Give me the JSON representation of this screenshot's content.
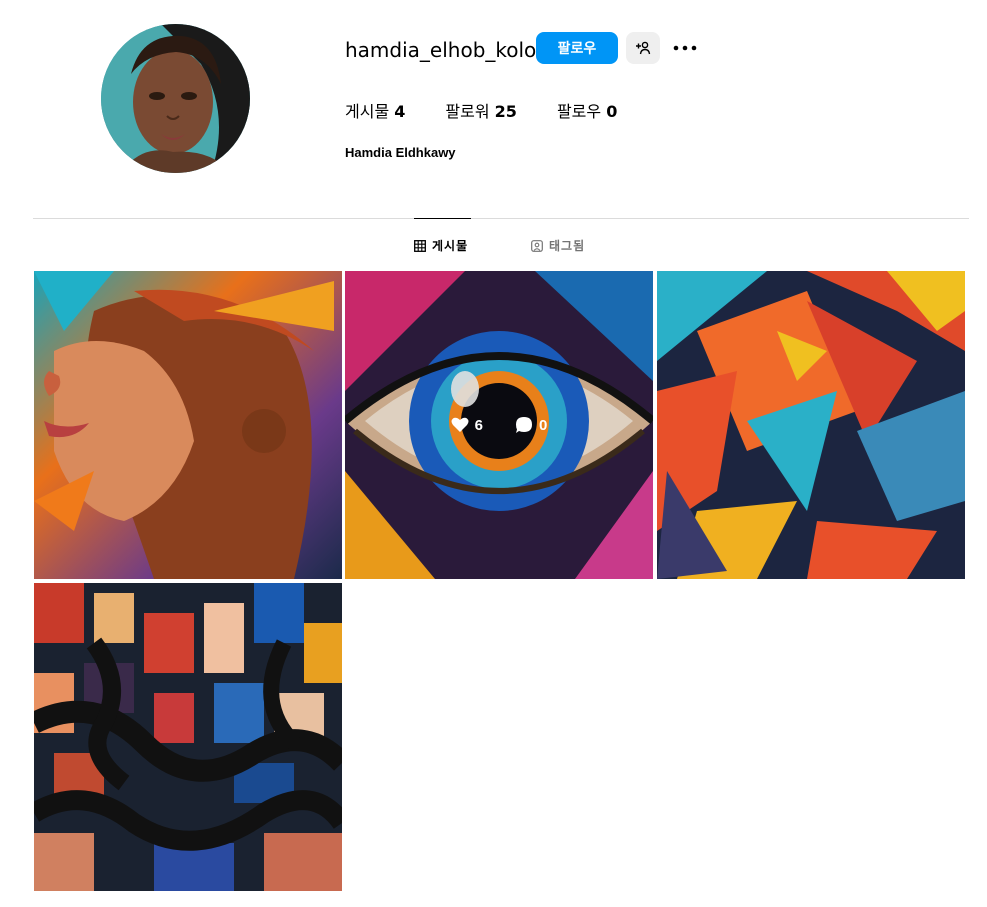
{
  "profile": {
    "username": "hamdia_elhob_kolo",
    "full_name": "Hamdia Eldhkawy",
    "follow_label": "팔로우",
    "suggest_icon": "add-person-icon",
    "more_icon": "more-horizontal-icon",
    "stats": {
      "posts_label": "게시물",
      "posts_count": "4",
      "followers_label": "팔로워",
      "followers_count": "25",
      "following_label": "팔로우",
      "following_count": "0"
    }
  },
  "tabs": {
    "posts_label": "게시물",
    "posts_icon": "grid-icon",
    "tagged_label": "태그됨",
    "tagged_icon": "tagged-person-icon"
  },
  "posts": [
    {
      "subject": "colorful painted woman portrait"
    },
    {
      "subject": "colorful eye close-up",
      "likes": "6",
      "comments": "0"
    },
    {
      "subject": "abstract geometric shapes"
    },
    {
      "subject": "comic collage with dark ribbons"
    }
  ],
  "colors": {
    "accent": "#0095f6",
    "divider": "#dbdbdb",
    "muted_text": "#737373"
  }
}
